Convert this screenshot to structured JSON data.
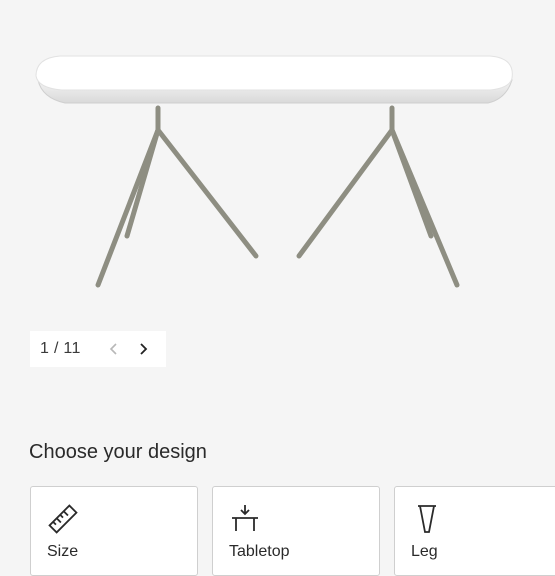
{
  "gallery": {
    "current": "1",
    "total": "11",
    "counter": "1 / 11",
    "prev_icon": "chevron-left-icon",
    "next_icon": "chevron-right-icon"
  },
  "design": {
    "heading": "Choose your design",
    "options": [
      {
        "label": "Size",
        "icon": "ruler-icon"
      },
      {
        "label": "Tabletop",
        "icon": "tabletop-icon"
      },
      {
        "label": "Leg",
        "icon": "leg-icon"
      }
    ]
  },
  "colors": {
    "background": "#f5f5f5",
    "table_top": "#ffffff",
    "table_legs": "#8e8e82"
  }
}
